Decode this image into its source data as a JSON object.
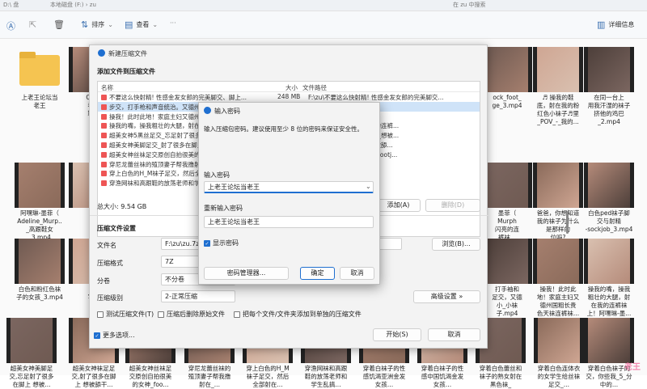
{
  "topbar": {
    "left1": "D:\\ 盘",
    "left2": "本地磁盘 (F:) › zu",
    "search": "在 zu 中搜索"
  },
  "toolbar": {
    "sort": "排序",
    "view": "查看",
    "details": "详细信息"
  },
  "tiles": [
    {
      "caption": "上老王论坛当\n老王",
      "kind": "folder"
    },
    {
      "caption": "Cand\n看底\n鞋底\n_",
      "kind": "video"
    },
    {
      "caption": "ock_foot_\nge_3.mp4",
      "kind": "video"
    },
    {
      "caption": "♬ 操我的鞋\n底，射在我的粉\n红色小袜子♬里\n_POV_-_我的...",
      "kind": "video"
    },
    {
      "caption": "在同一台上\n用我汗湿的袜子\n挤他的鸡巴\n_2.mp4",
      "kind": "video"
    },
    {
      "caption": "阿嘿琳-墨菲（\nAdeline_Murp..\n_高跟鞋女\n_3.mp4",
      "kind": "video"
    },
    {
      "caption": "阿\nAd\n高",
      "kind": "video"
    },
    {
      "caption": "墨菲（\nMurph\n闪亮的连\n裤袜...",
      "kind": "video"
    },
    {
      "caption": "爸爸，你想知道\n我的袜子为什么\n是那样的\n位吗?\nAdeline_Mur...",
      "kind": "video"
    },
    {
      "caption": "白色ped袜子脚\n交与射精\n-sockjob_3.mp4",
      "kind": "video"
    },
    {
      "caption": "白色和粉红色袜\n子的女孩_3.mp4",
      "kind": "video"
    },
    {
      "caption": "白\n写脚",
      "kind": "video"
    },
    {
      "caption": "打手袖和\n足交，又德\n小_小袜\n子.mp4",
      "kind": "video"
    },
    {
      "caption": "操我！此时此\n地！家庭主妇又\n德州国粗长贵\n色天袜连裤袜...",
      "kind": "video"
    },
    {
      "caption": "操我的嘴，操我\n粗壮的大腿，射\n在我的连裤袜\n上！阿嘿琳-墨...",
      "kind": "video"
    },
    {
      "caption": "超美女神美脚足\n交,忘足射了很多\n在脚上 想被...",
      "kind": "video"
    },
    {
      "caption": "超美女神袜足足\n交,射了很多在脚\n上 想被舔干...",
      "kind": "video"
    },
    {
      "caption": "超美女神丝袜足\n交原创自拍很美\n的女神_foo...",
      "kind": "video"
    },
    {
      "caption": "穿尼龙蕾丝袜的\n殖顶妻子帮我撸\n射在_...",
      "kind": "video"
    },
    {
      "caption": "穿上白色的H_M\n袜子足交，然后\n全部射在...",
      "kind": "video"
    },
    {
      "caption": "穿渔网袜和高跟\n鞋的放荡老师和\n学生乱搞...",
      "kind": "video"
    },
    {
      "caption": "穿着白袜子的性\n感饥渴亚洲金发\n女孩…",
      "kind": "video"
    },
    {
      "caption": "穿着白袜子的性\n感中国饥渴金发\n女孩…",
      "kind": "video"
    },
    {
      "caption": "穿着白色蕾丝和\n袜子的熟女射在\n黑色袜_",
      "kind": "video"
    },
    {
      "caption": "穿着白色连体衣\n的女学生给丝袜\n足交_...",
      "kind": "video"
    },
    {
      "caption": "穿着白色袜子的\n交，你些我_5_分\n中的...",
      "kind": "video"
    }
  ],
  "dialog": {
    "title": "新建压缩文件",
    "section_add": "添加文件到压缩文件",
    "col_name": "名称",
    "col_size": "大小",
    "col_path": "文件路径",
    "rows": [
      {
        "name": "不要这么快射精! 性感金发女郎的完美脚交、脚上...",
        "size": "248 MB",
        "path": "F:\\zu\\不要这么快射精! 性感金发女郎的完美脚交..."
      },
      {
        "name": "步交，打手枪和声音统治。又德州-墨菲（A...",
        "size": "",
        "path": "（A..."
      },
      {
        "name": "操我！此时此地！家庭主妇又德州国粗长贵色...",
        "size": "",
        "path": "色..."
      },
      {
        "name": "操我的嘴，操我粗壮的大腿，射在我的连...",
        "size": "",
        "path": "操我粗壮的大腿，射在我的连裤..."
      },
      {
        "name": "超美女神5黑丝足交_忘足射了很多在脚上_想被...",
        "size": "",
        "path": "足交_忘足射了很多在脚上_想被..."
      },
      {
        "name": "超美女神美脚足交_射了很多在脚上_想被舔干...",
        "size": "",
        "path": "足交_射了很多在脚上_想被舔..."
      },
      {
        "name": "超美女神丝袜足交原创自拍很美的女神_footj...",
        "size": "",
        "path": "足交原创自拍很美的女神_footj..."
      },
      {
        "name": "穿尼龙蕾丝袜的殖顶妻子帮我撸射到_-_...",
        "size": "",
        "path": "顶妻子帮我撸射到_-_Ad..."
      },
      {
        "name": "穿上白色的H_M袜子足交，然后全部射在...",
        "size": "",
        "path": "交，然后全部射在..."
      },
      {
        "name": "穿渔网袜和高跟鞋的放荡老师和学生乱搞...",
        "size": "",
        "path": "放荡老师和学生乱搞。"
      }
    ],
    "total": "总大小: 9.54 GB",
    "btn_add": "添加(A)",
    "btn_delete": "删除(D)",
    "section_settings": "压缩文件设置",
    "lbl_filename": "文件名",
    "val_filename": "F:\\zu\\zu.7z",
    "btn_browse": "浏览(B)...",
    "lbl_format": "压缩格式",
    "val_format": "7Z",
    "lbl_split": "分卷",
    "val_split": "不分卷",
    "lbl_level": "压缩级别",
    "val_level": "2-正常压缩",
    "btn_advanced": "高级设置 »",
    "chk_test": "测试压缩文件(T)",
    "chk_delete": "压缩后删除原始文件",
    "chk_each": "把每个文件/文件夹添加到单独的压缩文件",
    "chk_more": "更多选项...",
    "btn_start": "开始(S)",
    "btn_cancel": "取消"
  },
  "password": {
    "title": "输入密码",
    "prompt": "输入压缩包密码。建议使用至少 8 位的密码来保证安全性。",
    "lbl_enter": "输入密码",
    "val_enter": "上老王论坛当老王",
    "lbl_reenter": "重新输入密码",
    "val_reenter": "上老王论坛当老王",
    "chk_show": "显示密码",
    "btn_manager": "密码管理器...",
    "btn_ok": "确定",
    "btn_cancel": "取消"
  },
  "watermark": "老王"
}
